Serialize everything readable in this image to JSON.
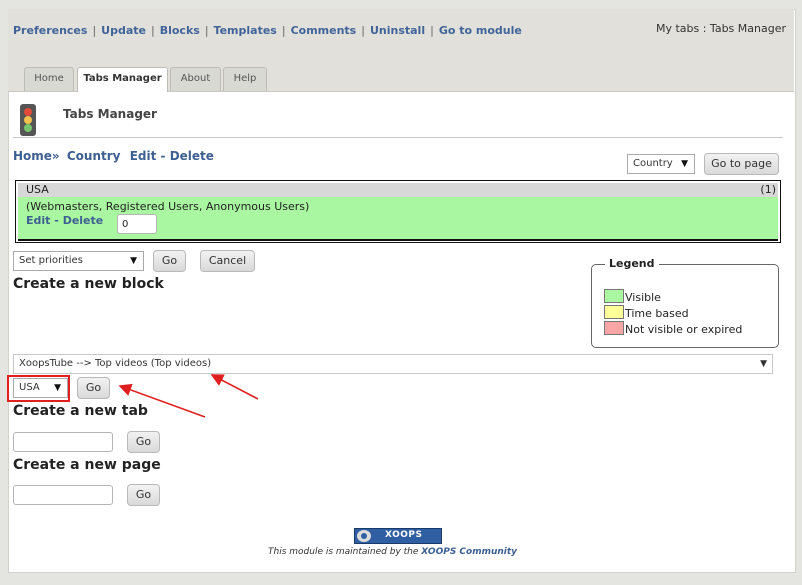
{
  "admin_menu": {
    "links": [
      "Preferences",
      "Update",
      "Blocks",
      "Templates",
      "Comments",
      "Uninstall",
      "Go to module"
    ],
    "context": "My tabs : Tabs Manager"
  },
  "module_tabs": [
    "Home",
    "Tabs Manager",
    "About",
    "Help"
  ],
  "active_tab": "Tabs Manager",
  "page_title": "Tabs Manager",
  "breadcrumb": {
    "home": "Home»",
    "country": "Country",
    "edit": "Edit",
    "dash": "-",
    "delete": "Delete"
  },
  "page_select": {
    "value": "Country",
    "button": "Go to page"
  },
  "tab_item": {
    "name": "USA",
    "count": "(1)",
    "groups": "(Webmasters, Registered Users, Anonymous Users)",
    "edit": "Edit",
    "dash": "-",
    "delete": "Delete",
    "priority": "0"
  },
  "priorities": {
    "value": "Set priorities",
    "go": "Go",
    "cancel": "Cancel"
  },
  "legend": {
    "title": "Legend",
    "items": [
      {
        "label": "Visible",
        "color": "#a9f7a1"
      },
      {
        "label": "Time based",
        "color": "#ffff99"
      },
      {
        "label": "Not visible or expired",
        "color": "#f7a5a5"
      }
    ]
  },
  "create_block": {
    "heading": "Create a new block",
    "block_select": "XoopsTube --> Top videos (Top videos)",
    "tab_select": "USA",
    "go": "Go"
  },
  "create_tab": {
    "heading": "Create a new tab",
    "value": "",
    "go": "Go"
  },
  "create_page": {
    "heading": "Create a new page",
    "value": "",
    "go": "Go"
  },
  "footer": {
    "logo_text": "XOOPS",
    "text": "This module is maintained by the",
    "brand": "XOOPS Community"
  },
  "annotation_color": "#e02020"
}
